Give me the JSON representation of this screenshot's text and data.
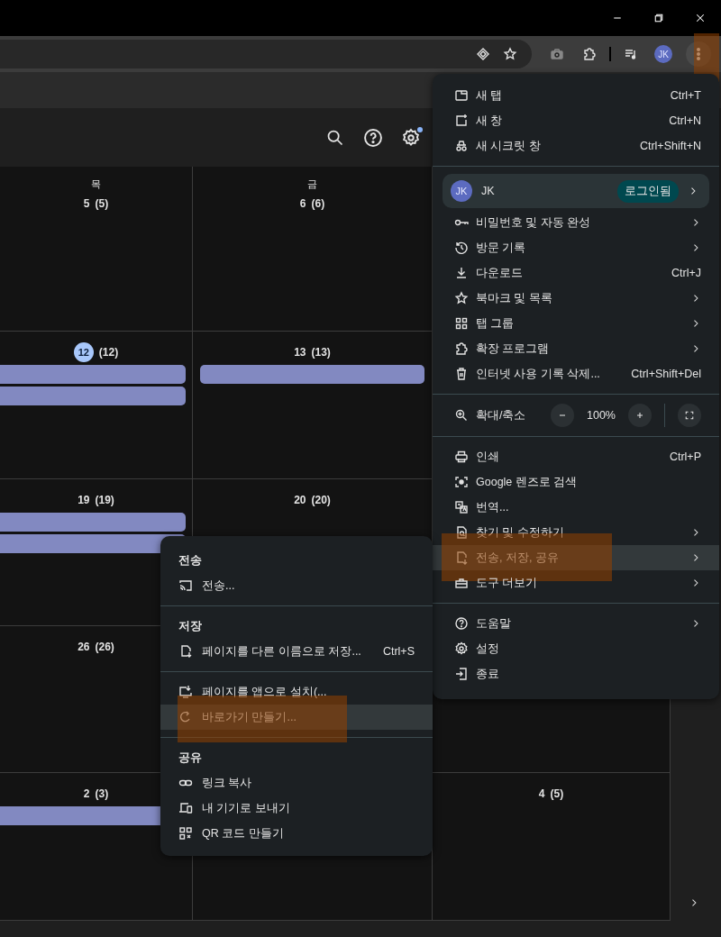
{
  "toolbar": {
    "avatar": "JK",
    "menu_button": {
      "highlighted": true
    }
  },
  "page_header": {
    "settings_badge": true
  },
  "calendar": {
    "weekdays": [
      "목",
      "금"
    ],
    "weeks": [
      {
        "days": [
          {
            "kind": "date",
            "date": "5",
            "sub": "(5)",
            "today": false
          },
          {
            "kind": "date",
            "date": "6",
            "sub": "(6)",
            "today": false
          }
        ]
      },
      {
        "days": [
          {
            "kind": "date",
            "date": "12",
            "sub": "(12)",
            "today": true,
            "events": [
              {
                "kind": "bar"
              },
              {
                "kind": "bar"
              }
            ]
          },
          {
            "kind": "date",
            "date": "13",
            "sub": "(13)",
            "today": false,
            "events": [
              {
                "kind": "bar"
              }
            ]
          }
        ]
      },
      {
        "days": [
          {
            "kind": "date",
            "date": "19",
            "sub": "(19)",
            "today": false,
            "events": [
              {
                "kind": "bar"
              },
              {
                "kind": "bar"
              }
            ]
          },
          {
            "kind": "date",
            "date": "20",
            "sub": "(20)",
            "today": false
          }
        ]
      },
      {
        "days": [
          {
            "kind": "date",
            "date": "26",
            "sub": "(26)",
            "today": false
          },
          {
            "kind": "hidden"
          },
          {
            "kind": "empty"
          }
        ]
      },
      {
        "days": [
          {
            "kind": "date",
            "date": "2",
            "sub": "(3)",
            "today": false,
            "events": [
              {
                "kind": "bar"
              }
            ]
          },
          {
            "kind": "empty"
          },
          {
            "kind": "date",
            "date": "4",
            "sub": "(5)",
            "today": false
          }
        ]
      }
    ]
  },
  "menu": {
    "sections": [
      {
        "items": [
          {
            "kind": "item",
            "label": "새 탭",
            "shortcut": "Ctrl+T"
          },
          {
            "kind": "item",
            "label": "새 창",
            "shortcut": "Ctrl+N"
          },
          {
            "kind": "item",
            "label": "새 시크릿 창",
            "shortcut": "Ctrl+Shift+N"
          }
        ]
      },
      {
        "items": [
          {
            "kind": "profile",
            "avatar": "JK",
            "label": "JK",
            "badge": "로그인됨",
            "submenu": true
          },
          {
            "kind": "item",
            "label": "비밀번호 및 자동 완성",
            "submenu": true
          },
          {
            "kind": "item",
            "label": "방문 기록",
            "submenu": true
          },
          {
            "kind": "item",
            "label": "다운로드",
            "shortcut": "Ctrl+J"
          },
          {
            "kind": "item",
            "label": "북마크 및 목록",
            "submenu": true
          },
          {
            "kind": "item",
            "label": "탭 그룹",
            "submenu": true
          },
          {
            "kind": "item",
            "label": "확장 프로그램",
            "submenu": true
          },
          {
            "kind": "item",
            "label": "인터넷 사용 기록 삭제...",
            "shortcut": "Ctrl+Shift+Del"
          }
        ]
      },
      {
        "items": [
          {
            "kind": "zoom",
            "label": "확대/축소",
            "value": "100%"
          }
        ]
      },
      {
        "items": [
          {
            "kind": "item",
            "label": "인쇄",
            "shortcut": "Ctrl+P"
          },
          {
            "kind": "item",
            "label": "Google 렌즈로 검색"
          },
          {
            "kind": "item",
            "label": "번역..."
          },
          {
            "kind": "item",
            "label": "찾기 및 수정하기",
            "submenu": true
          },
          {
            "kind": "item",
            "label": "전송, 저장, 공유",
            "submenu": true,
            "hovered": true,
            "highlighted": true
          },
          {
            "kind": "item",
            "label": "도구 더보기",
            "submenu": true
          }
        ]
      },
      {
        "items": [
          {
            "kind": "item",
            "label": "도움말",
            "submenu": true
          },
          {
            "kind": "item",
            "label": "설정"
          },
          {
            "kind": "item",
            "label": "종료"
          }
        ]
      }
    ]
  },
  "submenu": {
    "sections": [
      {
        "heading": "전송",
        "items": [
          {
            "label": "전송..."
          }
        ]
      },
      {
        "heading": "저장",
        "items": [
          {
            "label": "페이지를 다른 이름으로 저장...",
            "shortcut": "Ctrl+S"
          }
        ]
      },
      {
        "items": [
          {
            "label": "페이지를 앱으로 설치(..."
          },
          {
            "label": "바로가기 만들기...",
            "hovered": true,
            "highlighted": true
          }
        ]
      },
      {
        "heading": "공유",
        "items": [
          {
            "label": "링크 복사"
          },
          {
            "label": "내 기기로 보내기"
          },
          {
            "label": "QR 코드 만들기"
          }
        ]
      }
    ]
  }
}
